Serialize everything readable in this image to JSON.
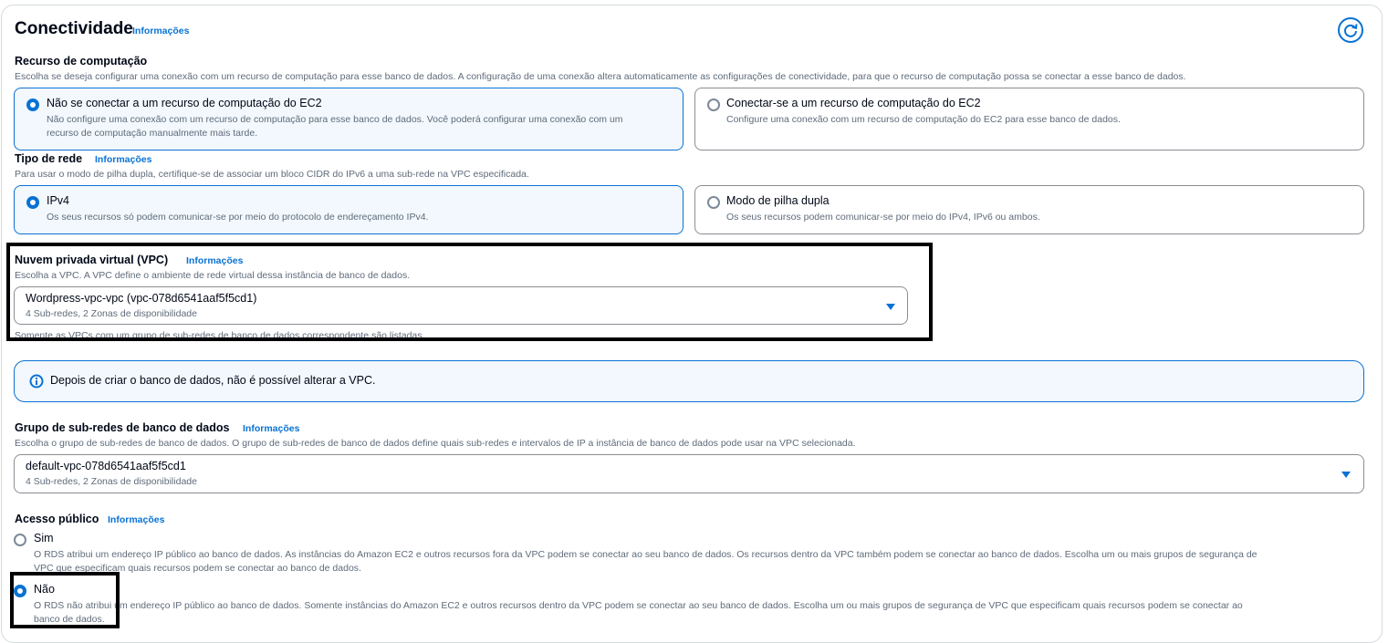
{
  "section": {
    "title": "Conectividade",
    "info": "Informações"
  },
  "compute": {
    "label": "Recurso de computação",
    "description": "Escolha se deseja configurar uma conexão com um recurso de computação para esse banco de dados. A configuração de uma conexão altera automaticamente as configurações de conectividade, para que o recurso de computação possa se conectar a esse banco de dados.",
    "options": [
      {
        "title": "Não se conectar a um recurso de computação do EC2",
        "desc_line1": "Não configure uma conexão com um recurso de computação para esse banco de dados. Você poderá configurar uma conexão com um",
        "desc_line2": "recurso de computação manualmente mais tarde.",
        "selected": true
      },
      {
        "title": "Conectar-se a um recurso de computação do EC2",
        "desc_line1": "Configure uma conexão com um recurso de computação do EC2 para esse banco de dados.",
        "selected": false
      }
    ]
  },
  "network": {
    "label": "Tipo de rede",
    "info": "Informações",
    "description": "Para usar o modo de pilha dupla, certifique-se de associar um bloco CIDR do IPv6 a uma sub-rede na VPC especificada.",
    "options": [
      {
        "title": "IPv4",
        "desc": "Os seus recursos só podem comunicar-se por meio do protocolo de endereçamento IPv4.",
        "selected": true
      },
      {
        "title": "Modo de pilha dupla",
        "desc": "Os seus recursos podem comunicar-se por meio do IPv4, IPv6 ou ambos.",
        "selected": false
      }
    ]
  },
  "vpc": {
    "label": "Nuvem privada virtual (VPC)",
    "info": "Informações",
    "description": "Escolha a VPC. A VPC define o ambiente de rede virtual dessa instância de banco de dados.",
    "value": "Wordpress-vpc-vpc (vpc-078d6541aaf5f5cd1)",
    "sub": "4 Sub-redes, 2 Zonas de disponibilidade",
    "hint": "Somente as VPCs com um grupo de sub-redes de banco de dados correspondente são listadas."
  },
  "alert": {
    "text": "Depois de criar o banco de dados, não é possível alterar a VPC."
  },
  "subnet_group": {
    "label": "Grupo de sub-redes de banco de dados",
    "info": "Informações",
    "description": "Escolha o grupo de sub-redes de banco de dados. O grupo de sub-redes de banco de dados define quais sub-redes e intervalos de IP a instância de banco de dados pode usar na VPC selecionada.",
    "value": "default-vpc-078d6541aaf5f5cd1",
    "sub": "4 Sub-redes, 2 Zonas de disponibilidade"
  },
  "public_access": {
    "label": "Acesso público",
    "info": "Informações",
    "options": [
      {
        "title": "Sim",
        "desc_line1": "O RDS atribui um endereço IP público ao banco de dados. As instâncias do Amazon EC2 e outros recursos fora da VPC podem se conectar ao seu banco de dados. Os recursos dentro da VPC também podem se conectar ao banco de dados. Escolha um ou mais grupos de segurança de",
        "desc_line2": "VPC que especificam quais recursos podem se conectar ao banco de dados.",
        "selected": false
      },
      {
        "title": "Não",
        "desc_line1": "O RDS não atribui um endereço IP público ao banco de dados. Somente instâncias do Amazon EC2 e outros recursos dentro da VPC podem se conectar ao seu banco de dados. Escolha um ou mais grupos de segurança de VPC que especificam quais recursos podem se conectar ao",
        "desc_line2": "banco de dados.",
        "selected": true
      }
    ]
  },
  "colors": {
    "accent": "#0972d3",
    "selected_bg": "#f2f8fd",
    "text": "#000716",
    "muted": "#5f6b7a"
  }
}
